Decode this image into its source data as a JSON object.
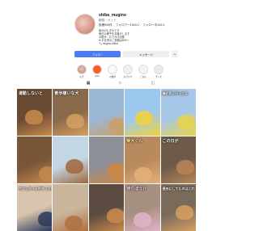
{
  "profile": {
    "username": "shiba_mugino",
    "category": "動物・ペット",
    "stats": [
      "投稿999件",
      "フォロワー1000人",
      "フォロー中100人"
    ],
    "bio": [
      "柴犬のむぎのです",
      "毎日の様子をお届けします",
      "お散歩・おでかけ記録",
      "✉ お仕事のご依頼はDMへ",
      "🐾 mugino.shiba"
    ],
    "follow_label": "フォロー",
    "message_label": "メッセージ",
    "more_label": "⌄"
  },
  "highlights": [
    {
      "label": "むぎ",
      "icon": "dog-photo-icon"
    },
    {
      "label": "Q&A",
      "icon": "orange-logo-icon"
    },
    {
      "label": "お散歩",
      "icon": "text-logo-icon"
    },
    {
      "label": "おでかけ",
      "icon": "paw-icon"
    },
    {
      "label": "ごはん",
      "icon": "bowl-icon"
    },
    {
      "label": "グッズ",
      "icon": "goods-icon"
    }
  ],
  "tabs": [
    {
      "icon": "grid-icon",
      "glyph": "▦"
    },
    {
      "icon": "reels-icon",
      "glyph": "▷"
    },
    {
      "icon": "tagged-icon",
      "glyph": "◫"
    }
  ],
  "posts": [
    {
      "caption": "運動しないと",
      "bg": "#6b4a34",
      "accent": "#c98b4d",
      "style": ""
    },
    {
      "caption": "散歩嫌いな犬",
      "bg": "#8a6a4a",
      "accent": "#d6a060",
      "style": ""
    },
    {
      "caption": "",
      "bg": "#9ab8d6",
      "accent": "#c9a06a",
      "style": ""
    },
    {
      "caption": "",
      "bg": "#9cc8f0",
      "accent": "#f2d23a",
      "style": ""
    },
    {
      "caption": "梅花見に行ったよ",
      "bg": "#a7c7e8",
      "accent": "#e8d44a",
      "style": "small"
    },
    {
      "caption": "",
      "bg": "#7a5638",
      "accent": "#c48a4e",
      "style": ""
    },
    {
      "caption": "",
      "bg": "#c2d6e4",
      "accent": "#a0673c",
      "style": ""
    },
    {
      "caption": "",
      "bg": "#8d8f96",
      "accent": "#d08642",
      "style": ""
    },
    {
      "caption": "柴犬くん",
      "bg": "#b98a5e",
      "accent": "#e4b07a",
      "style": "yellow"
    },
    {
      "caption": "この日が",
      "bg": "#6e5a48",
      "accent": "#b98555",
      "style": ""
    },
    {
      "caption": "カフェタイム中すっといいよ",
      "bg": "#d9c4ad",
      "accent": "#2a3a5c",
      "style": "small"
    },
    {
      "caption": "",
      "bg": "#c9b49c",
      "accent": "#b07040",
      "style": ""
    },
    {
      "caption": "",
      "bg": "#5a4a40",
      "accent": "#c98b4d",
      "style": ""
    },
    {
      "caption": "待ちぼうけ",
      "bg": "#a89080",
      "accent": "#e0b4c8",
      "style": "pink"
    },
    {
      "caption": "過去にしてたのはこれ",
      "bg": "#7a6a5a",
      "accent": "#d6a060",
      "style": "small"
    }
  ]
}
